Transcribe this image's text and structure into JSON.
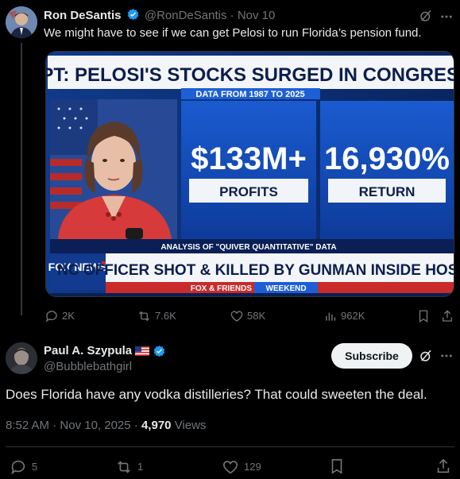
{
  "tweet": {
    "author_name": "Ron DeSantis",
    "handle": "@RonDeSantis",
    "separator": "·",
    "date": "Nov 10",
    "text": "We might have to see if we can get Pelosi to run Florida’s pension fund.",
    "media": {
      "headline": "RPT: PELOSI'S STOCKS SURGED IN CONGRESS",
      "subheadline": "DATA FROM 1987 TO 2025",
      "stat1_value": "$133M+",
      "stat1_label": "PROFITS",
      "stat2_value": "16,930%",
      "stat2_label": "RETURN",
      "source_note": "ANALYSIS OF \"QUIVER QUANTITATIVE\" DATA",
      "ticker": "NC OFFICER SHOT & KILLED BY GUNMAN INSIDE HOSPITAL",
      "network_logo": "FOX NEWS",
      "show_name": "FOX & FRIENDS",
      "show_suffix": "WEEKEND"
    },
    "stats": {
      "replies": "2K",
      "reposts": "7.6K",
      "likes": "58K",
      "views": "962K"
    }
  },
  "reply": {
    "author_name": "Paul A. Szypula",
    "handle": "@Bubblebathgirl",
    "subscribe_label": "Subscribe",
    "text": "Does Florida have any vodka distilleries? That could sweeten the deal.",
    "time": "8:52 AM",
    "date": "Nov 10, 2025",
    "separator": "·",
    "views_count": "4,970",
    "views_label": "Views",
    "stats": {
      "replies": "5",
      "reposts": "1",
      "likes": "129"
    }
  },
  "colors": {
    "verified": "#1d9bf0",
    "text": "#e7e9ea",
    "muted": "#71767b",
    "background": "#000000"
  }
}
